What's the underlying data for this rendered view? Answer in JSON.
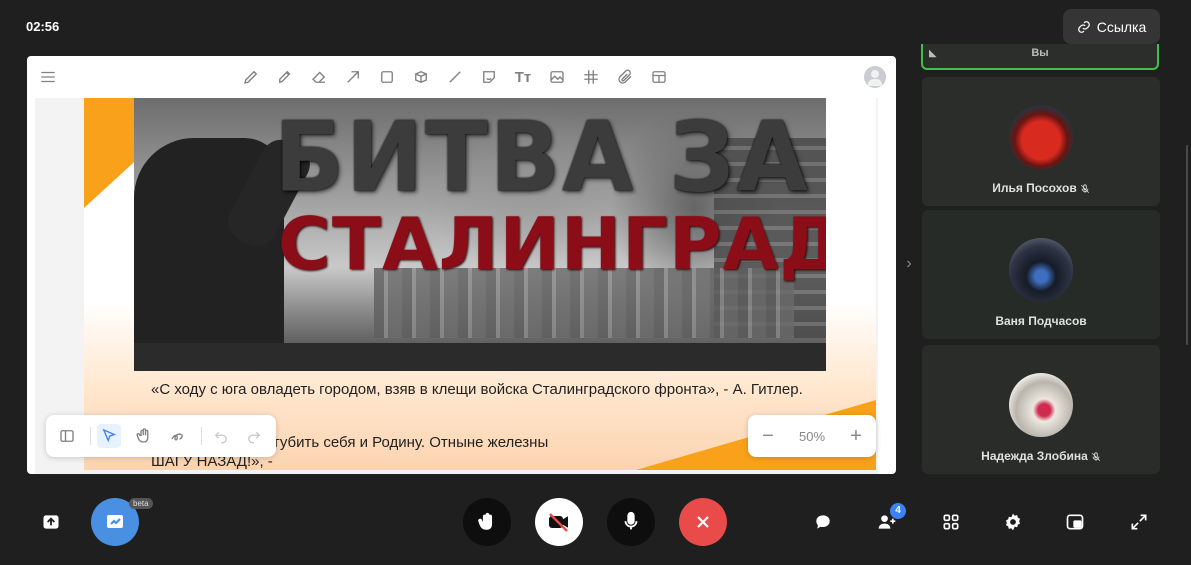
{
  "header": {
    "time": "02:56",
    "link_label": "Ссылка"
  },
  "board": {
    "toolbar_icons": [
      "menu-icon",
      "pencil-icon",
      "marker-icon",
      "eraser-icon",
      "arrow-icon",
      "rectangle-icon",
      "cube-icon",
      "line-icon",
      "sticker-icon",
      "text-icon",
      "image-icon",
      "grid-icon",
      "attachment-icon",
      "table-icon",
      "user-avatar-icon"
    ],
    "text_tool_label": "Tт",
    "slide": {
      "title_line1": "БИТВА ЗА",
      "title_line2": "СТАЛИНГРАД",
      "quote1": "«С ходу с юга овладеть городом, взяв в клещи войска Сталинградского фронта», - А. Гитлер.",
      "quote2": "альше– значит загубить себя и Родину. Отныне железны",
      "quote3": "ШАГУ НАЗАД!», -"
    },
    "zoom": {
      "value": "50%",
      "minus": "−",
      "plus": "+"
    }
  },
  "participants": {
    "self_label": "Вы",
    "tiles": [
      {
        "name": "Илья Посохов",
        "muted": true,
        "face_colors": [
          "#c8211a",
          "#3a3f4a"
        ]
      },
      {
        "name": "Ваня Подчасов",
        "muted": false,
        "face_colors": [
          "#1c2333",
          "#3b5b9a"
        ]
      },
      {
        "name": "Надежда Злобина",
        "muted": true,
        "face_colors": [
          "#e8e4dc",
          "#c3294a"
        ]
      }
    ]
  },
  "controls": {
    "beta_label": "beta",
    "participants_count": "4",
    "colors": {
      "whiteboard": "#4a90e2",
      "hangup": "#e94b4b",
      "dark": "#0e0e0e",
      "cam_off_bg": "#ffffff"
    }
  }
}
